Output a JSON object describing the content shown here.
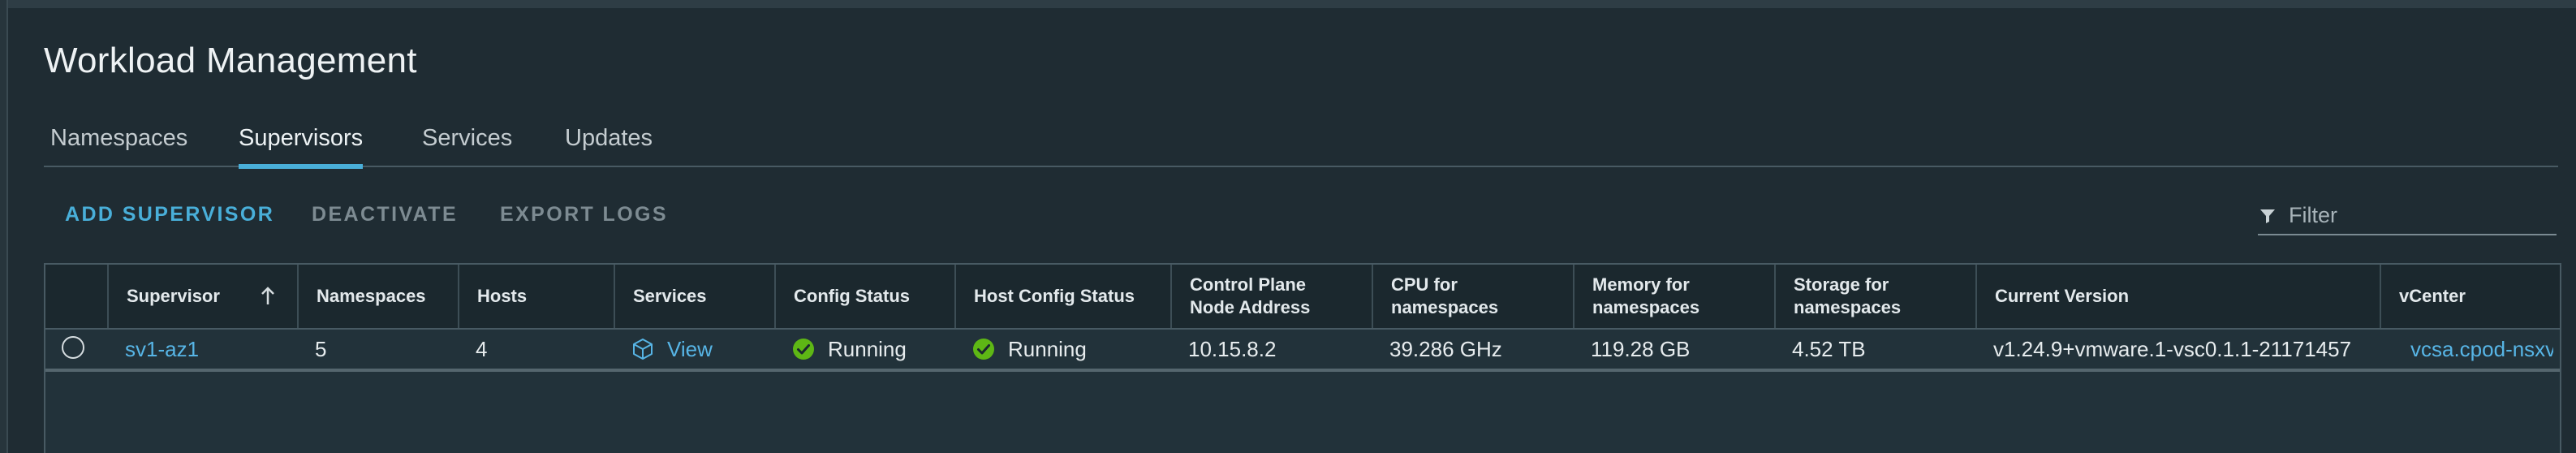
{
  "page": {
    "title": "Workload Management"
  },
  "tabs": [
    {
      "label": "Namespaces",
      "active": false
    },
    {
      "label": "Supervisors",
      "active": true
    },
    {
      "label": "Services",
      "active": false
    },
    {
      "label": "Updates",
      "active": false
    }
  ],
  "toolbar": {
    "add_label": "ADD SUPERVISOR",
    "deactivate_label": "DEACTIVATE",
    "export_label": "EXPORT LOGS",
    "filter_placeholder": "Filter"
  },
  "grid": {
    "columns": [
      {
        "line1": "Supervisor",
        "line2": ""
      },
      {
        "line1": "Namespaces",
        "line2": ""
      },
      {
        "line1": "Hosts",
        "line2": ""
      },
      {
        "line1": "Services",
        "line2": ""
      },
      {
        "line1": "Config Status",
        "line2": ""
      },
      {
        "line1": "Host Config Status",
        "line2": ""
      },
      {
        "line1": "Control Plane",
        "line2": "Node Address"
      },
      {
        "line1": "CPU for",
        "line2": "namespaces"
      },
      {
        "line1": "Memory for",
        "line2": "namespaces"
      },
      {
        "line1": "Storage for",
        "line2": "namespaces"
      },
      {
        "line1": "Current Version",
        "line2": ""
      },
      {
        "line1": "vCenter",
        "line2": ""
      }
    ],
    "sort_column": "Supervisor",
    "sort_direction": "ascending",
    "rows": [
      {
        "selected": false,
        "supervisor": "sv1-az1",
        "namespaces": "5",
        "hosts": "4",
        "services": "View",
        "config_status": "Running",
        "host_config_status": "Running",
        "control_plane_address": "10.15.8.2",
        "cpu": "39.286 GHz",
        "memory": "119.28 GB",
        "storage": "4.52 TB",
        "current_version": "v1.24.9+vmware.1-vsc0.1.1-21171457",
        "vcenter": "vcsa.cpod-nsxv"
      }
    ]
  },
  "colors": {
    "background": "#1f2c33",
    "accent": "#49afd9",
    "link": "#57b5e6",
    "success": "#5eb715"
  },
  "icons": {
    "sort": "arrow-up-icon",
    "filter": "filter-icon",
    "services": "cube-icon",
    "status": "check-circle-icon"
  }
}
